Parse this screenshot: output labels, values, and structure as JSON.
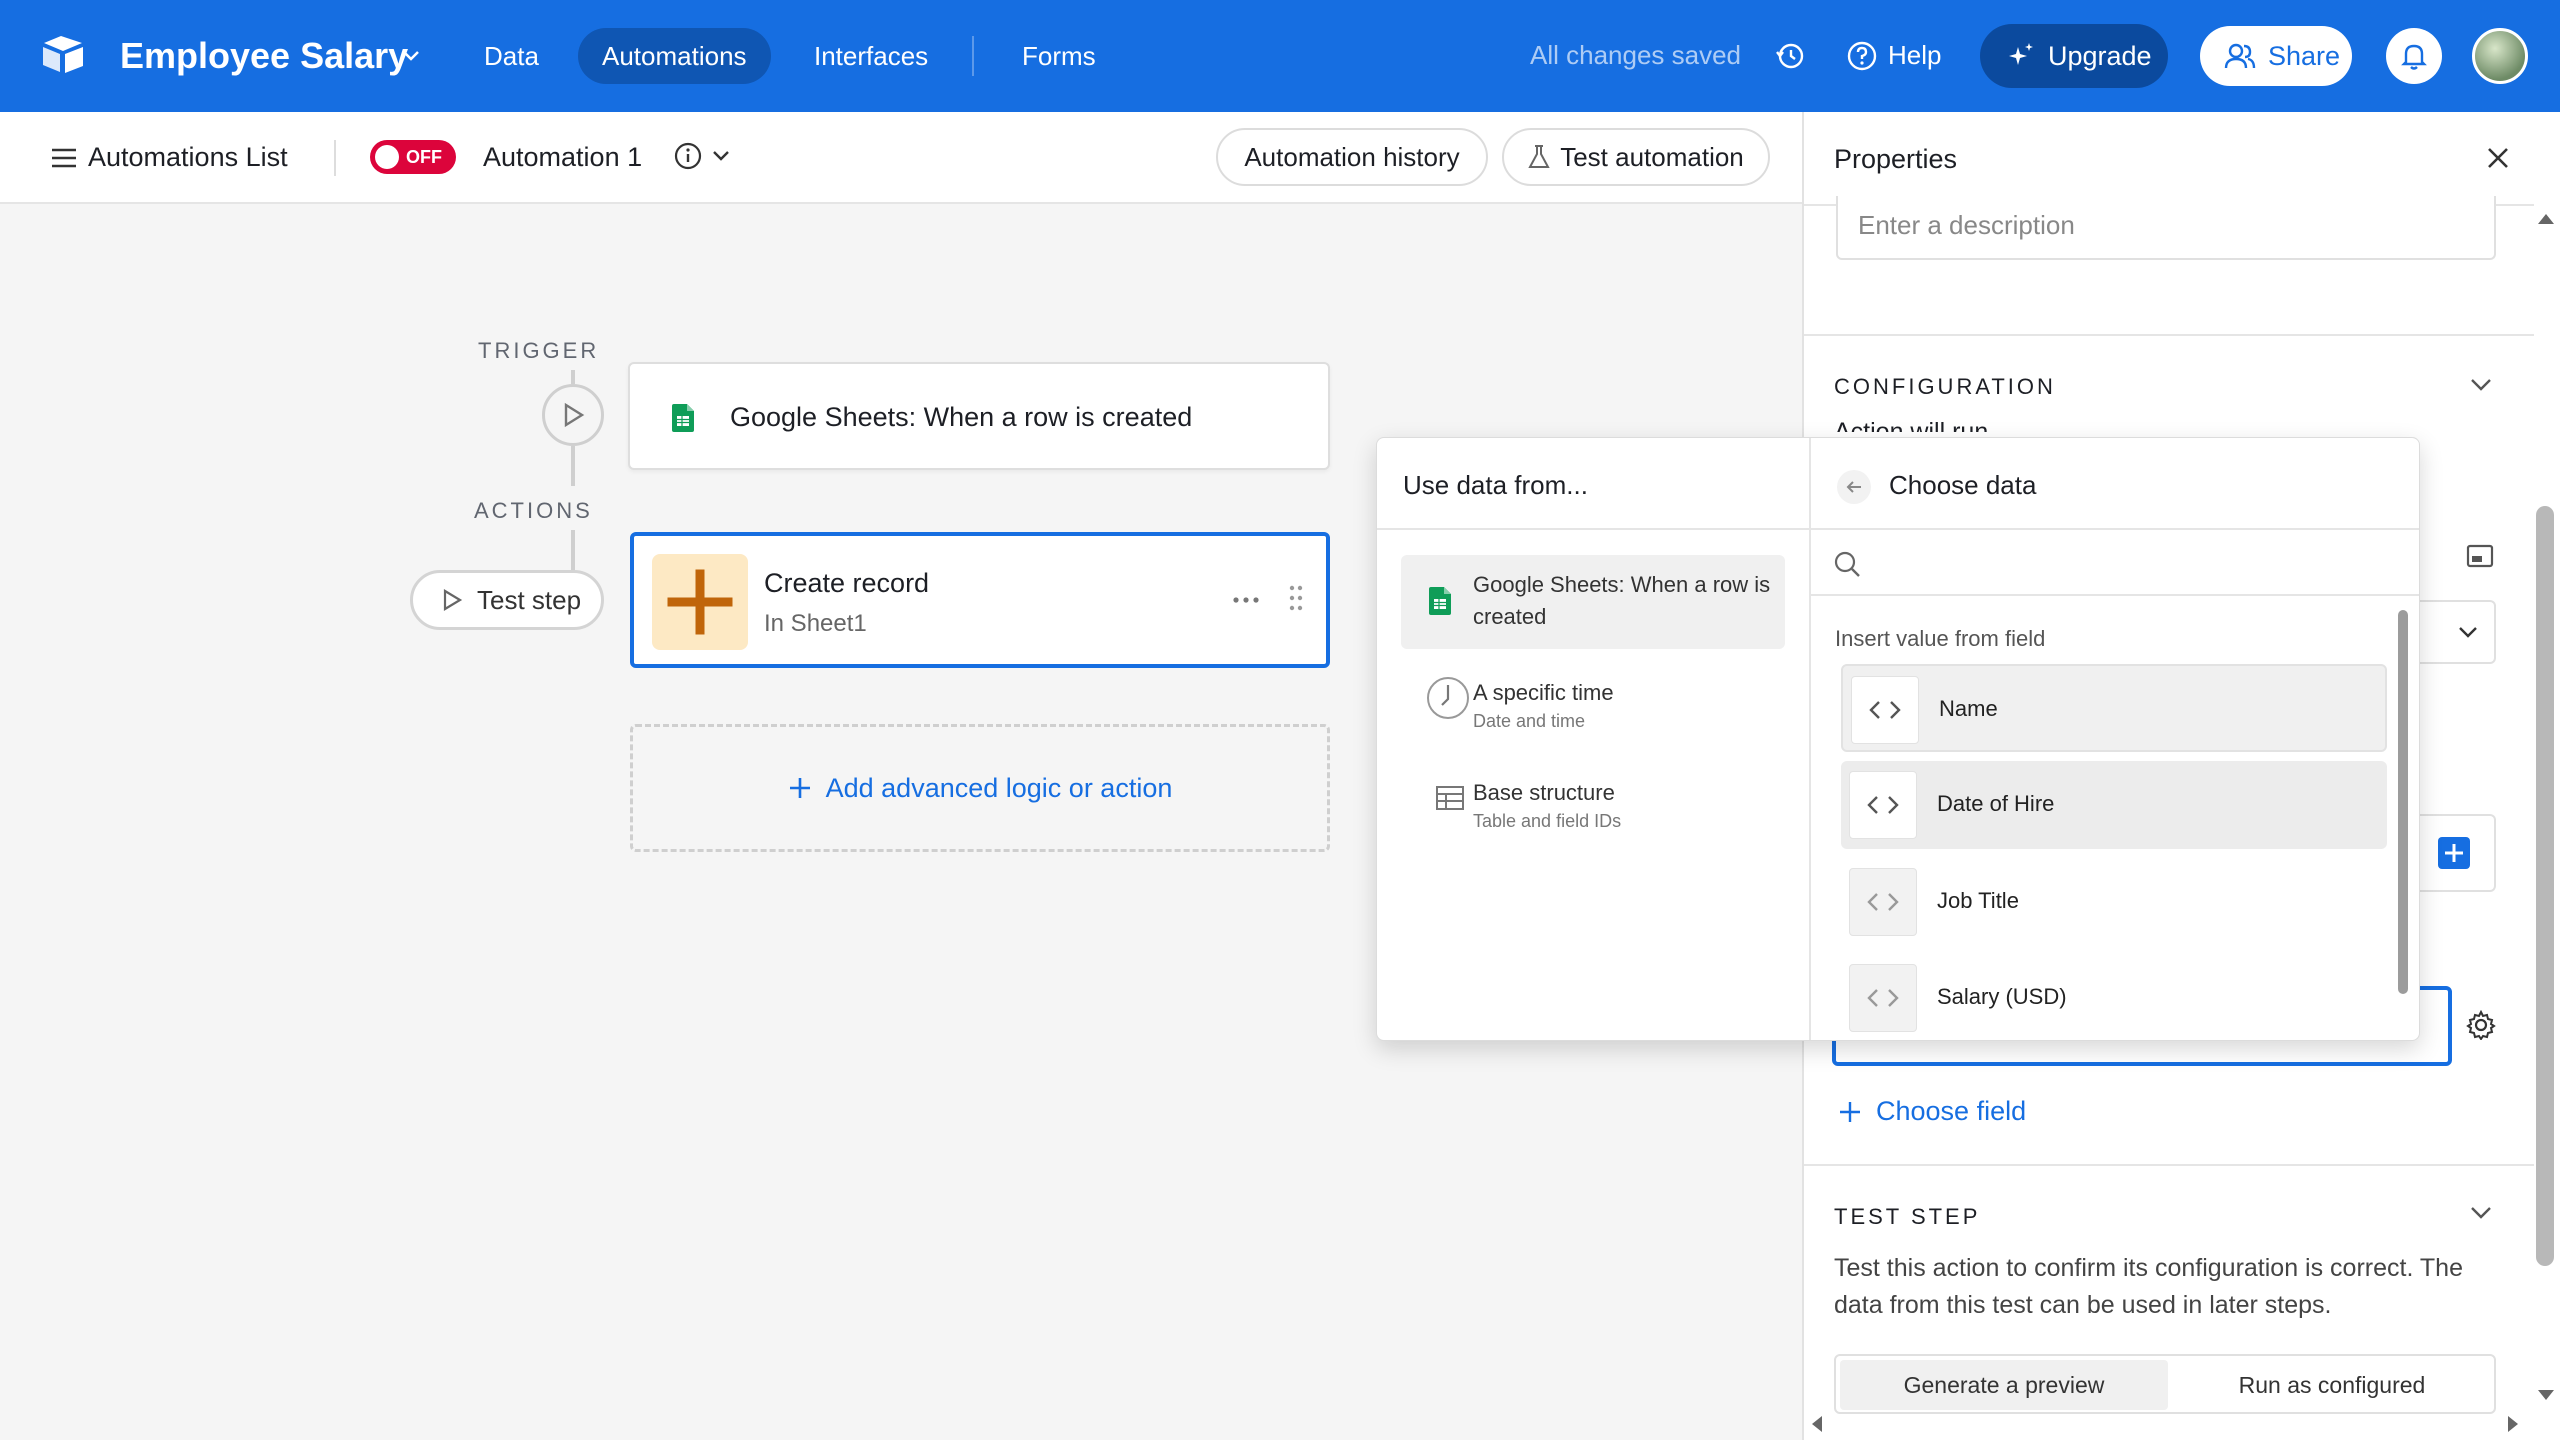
{
  "topbar": {
    "base_name": "Employee Salary",
    "nav": [
      "Data",
      "Automations",
      "Interfaces",
      "Forms"
    ],
    "active_nav": "Automations",
    "saved_status": "All changes saved",
    "help_label": "Help",
    "upgrade_label": "Upgrade",
    "share_label": "Share"
  },
  "subbar": {
    "automations_list_label": "Automations List",
    "toggle_label": "OFF",
    "automation_name": "Automation 1",
    "history_label": "Automation history",
    "test_automation_label": "Test automation"
  },
  "canvas": {
    "trigger_label": "TRIGGER",
    "actions_label": "ACTIONS",
    "trigger_text": "Google Sheets: When a row is created",
    "test_step_label": "Test step",
    "action_title": "Create record",
    "action_subtitle": "In Sheet1",
    "add_logic_label": "Add advanced logic or action"
  },
  "properties": {
    "title": "Properties",
    "description_placeholder": "Enter a description",
    "configuration_heading": "CONFIGURATION",
    "partial_text": "Action will run",
    "choose_field_label": "Choose field",
    "test_step_heading": "TEST STEP",
    "test_step_description": "Test this action to confirm its configuration is correct. The data from this test can be used in later steps.",
    "segmented": [
      "Generate a preview",
      "Run as configured"
    ],
    "selected_segment": "Generate a preview"
  },
  "popover": {
    "left_title": "Use data from...",
    "right_title": "Choose data",
    "sources": [
      {
        "title": "Google Sheets: When a row is created",
        "subtitle": "",
        "icon": "google-sheets-icon"
      },
      {
        "title": "A specific time",
        "subtitle": "Date and time",
        "icon": "clock-icon"
      },
      {
        "title": "Base structure",
        "subtitle": "Table and field IDs",
        "icon": "table-icon"
      }
    ],
    "search_placeholder": "",
    "insert_label": "Insert value from field",
    "fields": [
      "Name",
      "Date of Hire",
      "Job Title",
      "Salary (USD)"
    ]
  },
  "colors": {
    "brand_blue": "#166ee1",
    "toggle_off_red": "#dc043b",
    "sheets_green": "#0f9d58",
    "action_orange": "#c0650a"
  }
}
